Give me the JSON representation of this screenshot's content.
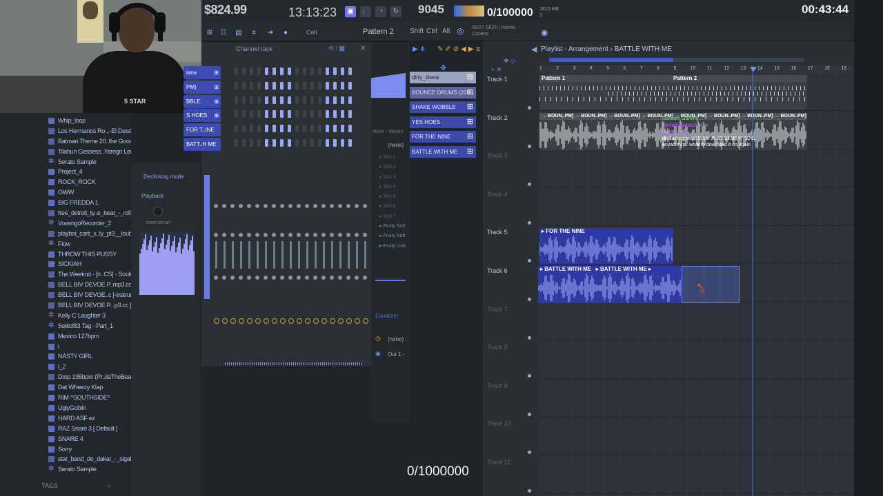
{
  "overlay": {
    "money": "$824.99",
    "clock": "13:13:23",
    "goal_top": "0/100000",
    "goal_bottom": "0/1000000",
    "timer": "00:43:44",
    "shirt_text": "5 STAR"
  },
  "toolbar": {
    "bpm_value": "9045",
    "memory_line1": "1812 MB",
    "memory_line2": "3",
    "pattern_label": "Pattern 2",
    "cell_label": "Cell",
    "key_shift": "Shift",
    "key_ctrl": "Ctrl",
    "key_alt": "Alt",
    "song_info_line1": "06/27  DEZII | Remix",
    "song_info_line2": "Contest"
  },
  "browser": {
    "items": [
      {
        "label": "Whip_loop",
        "icon": "folder-icon"
      },
      {
        "label": "Los Hermanos Ro...-El Desdichado",
        "icon": "audio-file-icon"
      },
      {
        "label": "Batman Theme 20..the Good Part",
        "icon": "audio-file-icon"
      },
      {
        "label": "Tilahun Gessess..Yaregn Lemije",
        "icon": "audio-file-icon"
      },
      {
        "label": "Serato Sample",
        "icon": "gear-icon"
      },
      {
        "label": "Project_4",
        "icon": "folder-icon"
      },
      {
        "label": "ROCK_ROCK",
        "icon": "folder-icon"
      },
      {
        "label": "OWW",
        "icon": "folder-icon"
      },
      {
        "label": "BIG FREDDA 1",
        "icon": "folder-icon"
      },
      {
        "label": "free_detroit_ty..e_beat_-_roll_up",
        "icon": "audio-file-icon"
      },
      {
        "label": "VoxengoRecorder_2",
        "icon": "gear-icon"
      },
      {
        "label": "playboi_carti_x..ly_pt3__loubeats",
        "icon": "audio-file-icon"
      },
      {
        "label": "Flow",
        "icon": "gear-icon"
      },
      {
        "label": "THROW THIS PUSSY",
        "icon": "folder-icon"
      },
      {
        "label": "SICKIAH",
        "icon": "folder-icon"
      },
      {
        "label": "The Weeknd - [n..CS] - Souless80",
        "icon": "audio-file-icon"
      },
      {
        "label": "BELL BIV DEVOE P..mp3.cc ]-bass",
        "icon": "audio-file-icon"
      },
      {
        "label": "BELL BIV DEVOE..c ]-instrumental",
        "icon": "audio-file-icon"
      },
      {
        "label": "BELL BIV DEVOE P...p3.cc ]-vocals",
        "icon": "audio-file-icon"
      },
      {
        "label": "Kelly C Laughter 3",
        "icon": "gear-icon"
      },
      {
        "label": "Seiitof83 Tag - Part_1",
        "icon": "gear-icon"
      },
      {
        "label": "Mexico 127bpm",
        "icon": "folder-icon"
      },
      {
        "label": "i",
        "icon": "folder-icon"
      },
      {
        "label": "NASTY GIRL",
        "icon": "folder-icon"
      },
      {
        "label": "i_2",
        "icon": "folder-icon"
      },
      {
        "label": "Drop 195bpm (Pr..llaTheBeatPlug",
        "icon": "audio-file-icon"
      },
      {
        "label": "Dat Wheezy Klap",
        "icon": "folder-icon"
      },
      {
        "label": "RIM ^SOUTHSIDE^",
        "icon": "folder-icon"
      },
      {
        "label": "UglyGoblin",
        "icon": "folder-icon"
      },
      {
        "label": "HARD ASF ez",
        "icon": "folder-icon"
      },
      {
        "label": "RAZ Snare 3 [ Default ]",
        "icon": "folder-icon"
      },
      {
        "label": "SNARE 4",
        "icon": "folder-icon"
      },
      {
        "label": "Sorry",
        "icon": "folder-icon"
      },
      {
        "label": "star_band_de_dakar_-_sigala",
        "icon": "audio-file-icon"
      },
      {
        "label": "Serato Sample",
        "icon": "gear-icon"
      }
    ],
    "tags_label": "TAGS"
  },
  "sampler": {
    "declicking_label": "Declicking mode",
    "playback_label": "Playback",
    "start_offset_label": "START OFFSET"
  },
  "channel_rack": {
    "title": "Channel rack",
    "channels": [
      "iana",
      "PM)",
      "BBLE",
      "S HOES",
      "FOR T..INE",
      "BATT..H ME"
    ]
  },
  "mixer": {
    "label": "Mixer - Master",
    "none_label": "(none)",
    "slots": [
      "Slot 1",
      "Slot 2",
      "Slot 3",
      "Slot 4",
      "Slot 5",
      "Slot 6",
      "Slot 7",
      "Fruity Soft",
      "Fruity Soft",
      "Fruity Limi"
    ],
    "equalizer_label": "Equalizer",
    "output_none": "(none)",
    "output_label": "Out 1 -"
  },
  "picker": {
    "items": [
      {
        "label": "dirty_diana",
        "style": "sel"
      },
      {
        "label": "BOUNCE DRUMS (200...",
        "style": "dim"
      },
      {
        "label": "SHAKE WOBBLE",
        "style": ""
      },
      {
        "label": "YES HOES",
        "style": ""
      },
      {
        "label": "FOR THE NINE",
        "style": ""
      },
      {
        "label": "BATTLE WITH ME",
        "style": ""
      }
    ]
  },
  "playlist": {
    "title": "Playlist - Arrangement › BATTLE WITH ME",
    "ruler": [
      "1",
      "2",
      "3",
      "4",
      "5",
      "6",
      "7",
      "8",
      "9",
      "10",
      "11",
      "12",
      "13",
      "14",
      "15",
      "16",
      "17",
      "18",
      "19"
    ],
    "tracks": [
      "Track 1",
      "Track 2",
      "Track 3",
      "Track 4",
      "Track 5",
      "Track 6",
      "Track 7",
      "Track 8",
      "Track 9",
      "Track 10",
      "Track 11"
    ],
    "clips": {
      "pattern1": "Pattern 1",
      "pattern2": "Pattern 2",
      "boun": "→ BOUN..PM] → BOUN..PM] → BOUN..PM] → BOUN..PM] → BOUN..PM] → BOUN..PM] → BOUN..PM] → BOUN..PM]",
      "for_the_nine": "FOR THE NINE",
      "battle1": "BATTLE WITH ME",
      "battle2": "BATTLE WITH ME"
    }
  },
  "chat": {
    "messages": [
      {
        "text": "Daleben Gaming",
        "color": "#60e060"
      },
      {
        "text": "djkillathegreat261998",
        "color": "#c060ff"
      },
      {
        "text": "anyastev.ta",
        "color": "#c060ff"
      },
      {
        "text": "djkillathegreat261998: JUST SENT IT TO U",
        "color": "#ffffff"
      },
      {
        "text": "anyastev.ta: what to download it on again",
        "color": "#ffffff"
      }
    ]
  },
  "colors": {
    "accent": "#6f74e8",
    "pattern_blue": "#3c49a8",
    "clip_blue": "#2e3aa0",
    "wave_blue": "#a8b0ff"
  }
}
